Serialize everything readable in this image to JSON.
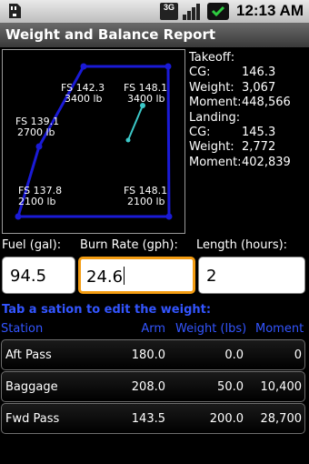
{
  "status": {
    "time": "12:13 AM",
    "network": "3G"
  },
  "header": {
    "title": "Weight and Balance Report"
  },
  "envelope": {
    "points": [
      {
        "label": "FS 142.3",
        "weight": "3400 lb"
      },
      {
        "label": "FS 148.1",
        "weight": "3400 lb"
      },
      {
        "label": "FS 139.1",
        "weight": "2700 lb"
      },
      {
        "label": "FS 137.8",
        "weight": "2100 lb"
      },
      {
        "label": "FS 148.1",
        "weight": "2100 lb"
      }
    ],
    "colors": {
      "envelope": "#1a1ad6",
      "cg_line": "#3cc8c8"
    }
  },
  "summary": {
    "takeoff_label": "Takeoff:",
    "takeoff": {
      "cg_label": "CG:",
      "cg": "146.3",
      "weight_label": "Weight:",
      "weight": "3,067",
      "moment_label": "Moment:",
      "moment": "448,566"
    },
    "landing_label": "Landing:",
    "landing": {
      "cg_label": "CG:",
      "cg": "145.3",
      "weight_label": "Weight:",
      "weight": "2,772",
      "moment_label": "Moment:",
      "moment": "402,839"
    }
  },
  "inputs": {
    "fuel": {
      "label": "Fuel (gal):",
      "value": "94.5"
    },
    "burn": {
      "label": "Burn Rate (gph):",
      "value": "24.6"
    },
    "length": {
      "label": "Length (hours):",
      "value": "2"
    }
  },
  "hint": "Tab a sation to edit the weight:",
  "table": {
    "headers": {
      "station": "Station",
      "arm": "Arm",
      "weight": "Weight (lbs)",
      "moment": "Moment"
    },
    "rows": [
      {
        "station": "Aft Pass",
        "arm": "180.0",
        "weight": "0.0",
        "moment": "0"
      },
      {
        "station": "Baggage",
        "arm": "208.0",
        "weight": "50.0",
        "moment": "10,400"
      },
      {
        "station": "Fwd Pass",
        "arm": "143.5",
        "weight": "200.0",
        "moment": "28,700"
      }
    ]
  },
  "colors": {
    "accent": "#3355ff",
    "focus": "#f39c12"
  }
}
